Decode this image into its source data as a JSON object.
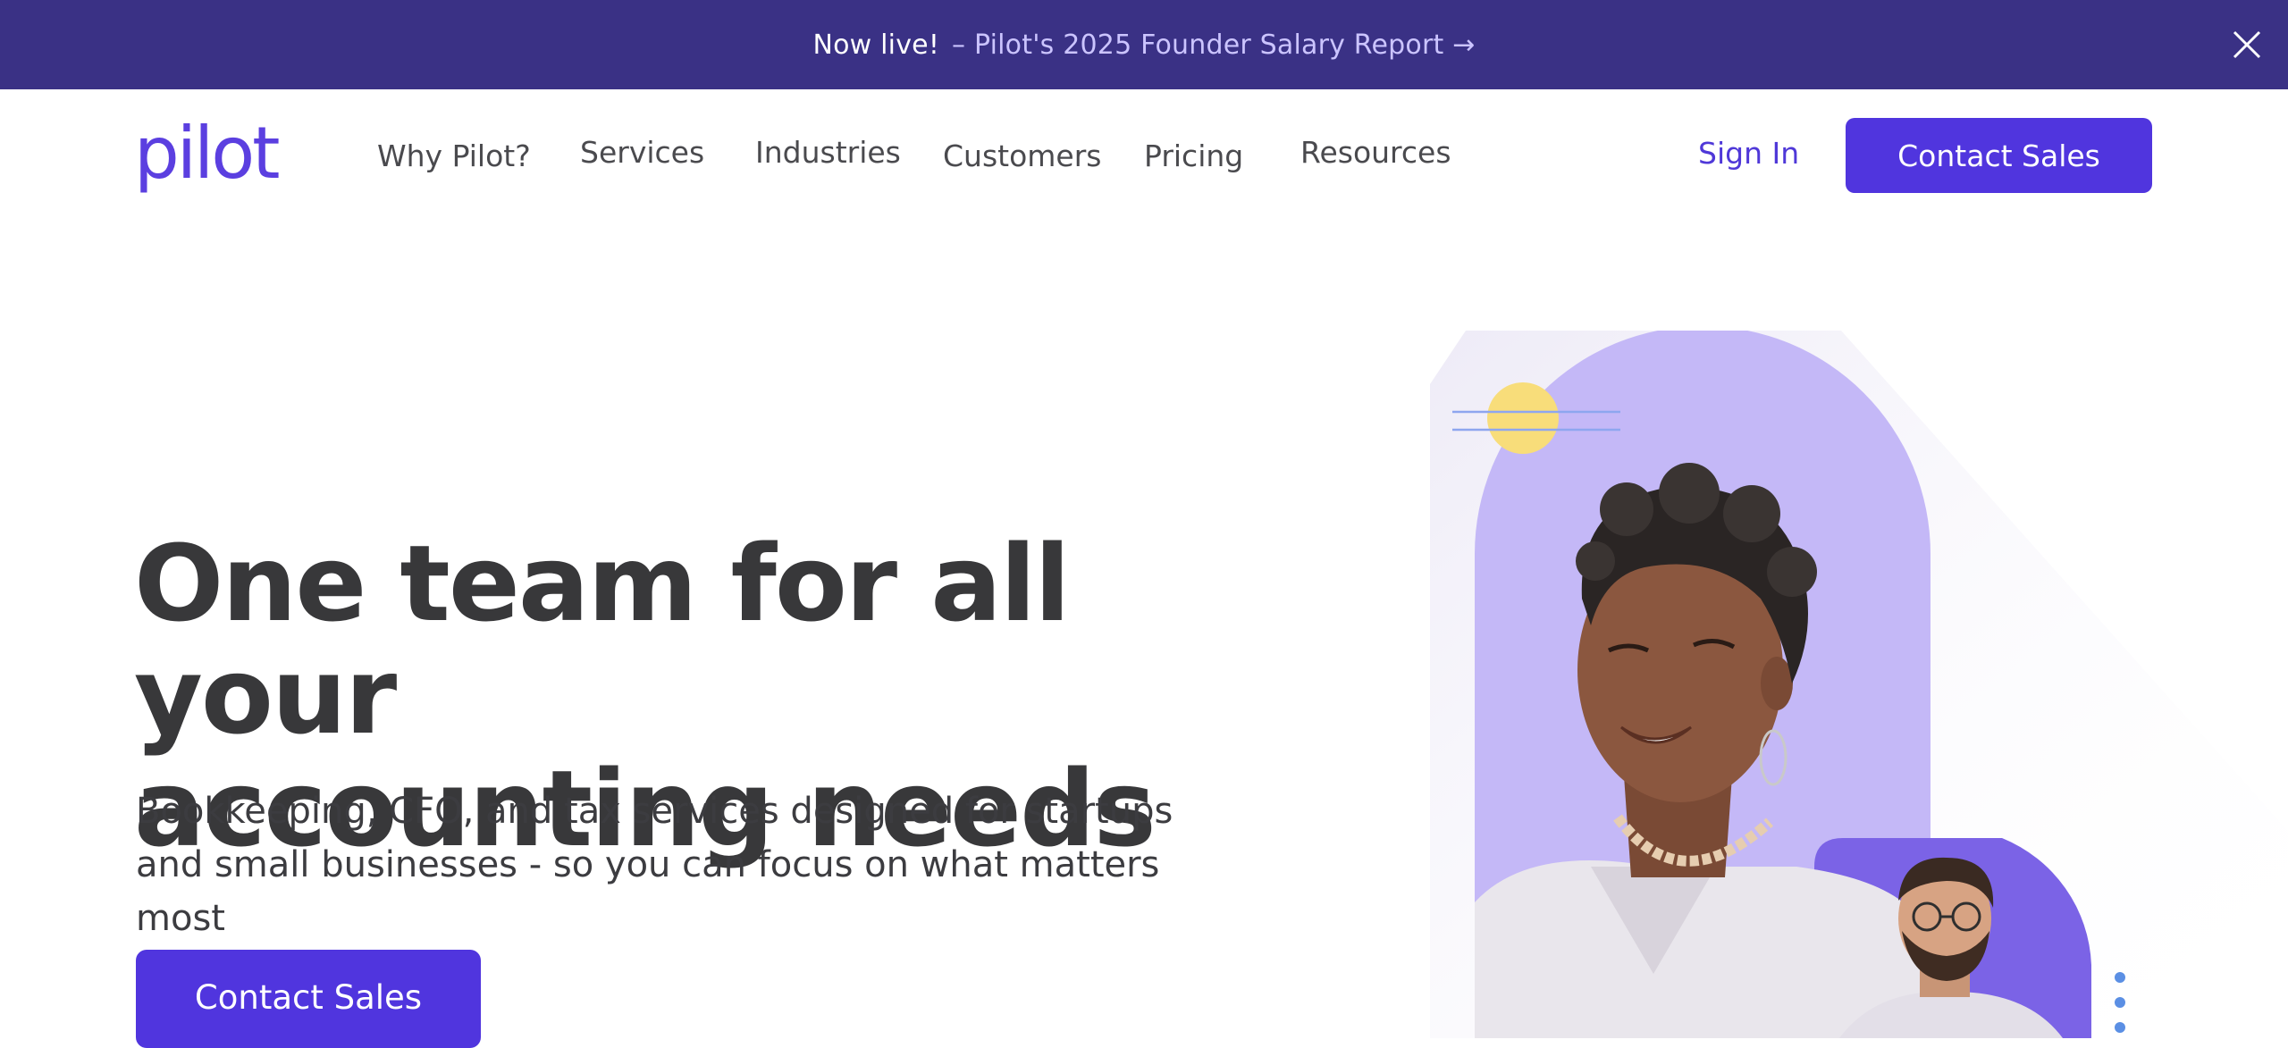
{
  "announcement": {
    "prefix": "Now live!",
    "link_text": "– Pilot's 2025 Founder Salary Report →",
    "close_icon": "close-icon"
  },
  "nav": {
    "logo": "pilot",
    "items": [
      {
        "label": "Why Pilot?"
      },
      {
        "label": "Services"
      },
      {
        "label": "Industries"
      },
      {
        "label": "Customers"
      },
      {
        "label": "Pricing"
      },
      {
        "label": "Resources"
      }
    ],
    "sign_in": "Sign In",
    "cta": "Contact Sales"
  },
  "hero": {
    "title_line1": "One team for all your",
    "title_line2": "accounting needs",
    "subtitle": "Bookkeeping, CFO, and tax services designed for startups and small businesses - so you can focus on what matters most",
    "cta": "Contact Sales"
  },
  "colors": {
    "brand": "#5035de",
    "announcement_bg": "#3a3185",
    "link_lavender": "#cbc4ff",
    "arch_lavender": "#c4b8f7",
    "arch_purple": "#7b63e6",
    "sun_yellow": "#f8dd7a"
  }
}
